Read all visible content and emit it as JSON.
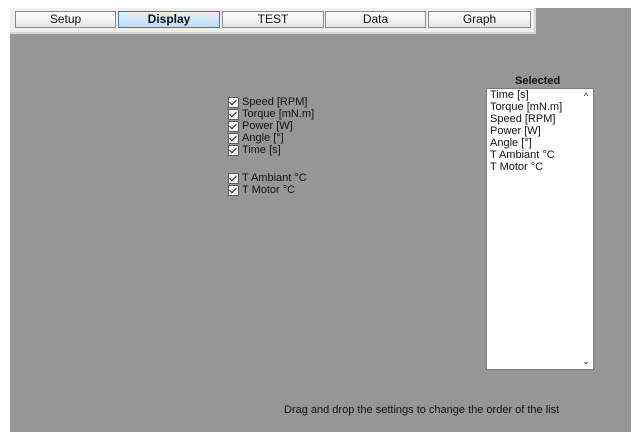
{
  "tabs": [
    {
      "label": "Setup"
    },
    {
      "label": "Display"
    },
    {
      "label": "TEST"
    },
    {
      "label": "Data"
    },
    {
      "label": "Graph"
    }
  ],
  "active_tab": "Display",
  "settings": [
    {
      "label": "Speed [RPM]",
      "checked": true
    },
    {
      "label": "Torque [mN.m]",
      "checked": true
    },
    {
      "label": "Power [W]",
      "checked": true
    },
    {
      "label": "Angle [°]",
      "checked": true
    },
    {
      "label": "Time [s]",
      "checked": true
    },
    {
      "label": "T Ambiant °C",
      "checked": true
    },
    {
      "label": "T Motor °C",
      "checked": true
    }
  ],
  "selected": {
    "title": "Selected",
    "items": [
      "Time [s]",
      "Torque [mN.m]",
      "Speed [RPM]",
      "Power [W]",
      "Angle [°]",
      "T Ambiant °C",
      "T Motor °C"
    ]
  },
  "hint": "Drag and drop the settings to change the order of the list",
  "colors": {
    "panel": "#969696",
    "active_tab": "#bcdcf4"
  }
}
